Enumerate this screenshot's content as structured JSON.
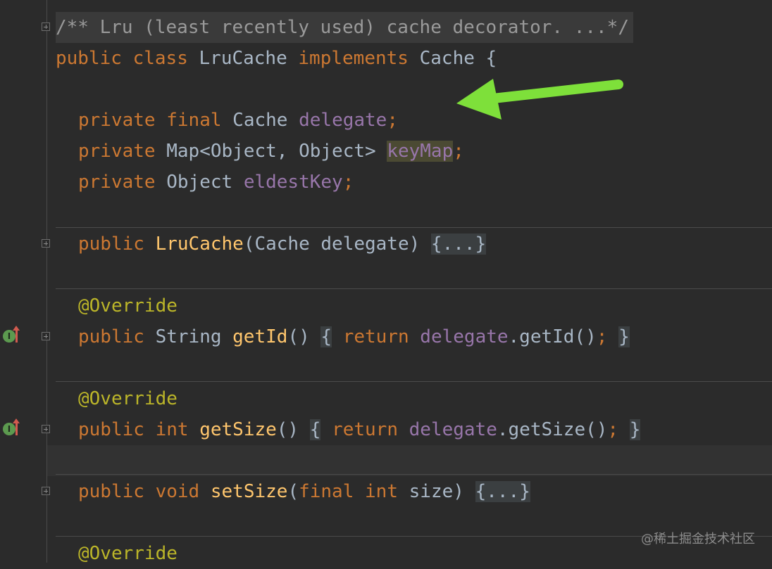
{
  "code": {
    "l1": {
      "text": "/** Lru (least recently used) cache decorator. ...*/"
    },
    "l2": {
      "kw1": "public",
      "kw2": "class",
      "name": "LruCache",
      "kw3": "implements",
      "iface": "Cache {"
    },
    "l4": {
      "kw1": "private",
      "kw2": "final",
      "type": "Cache",
      "field": "delegate",
      "semi": ";"
    },
    "l5": {
      "kw1": "private",
      "type": "Map<Object, Object>",
      "field": "keyMap",
      "semi": ";"
    },
    "l6": {
      "kw1": "private",
      "type": "Object",
      "field": "eldestKey",
      "semi": ";"
    },
    "l8": {
      "kw1": "public",
      "ctor": "LruCache",
      "params": "(Cache delegate)",
      "fold": "{...}"
    },
    "l10": {
      "ann": "@Override"
    },
    "l11": {
      "kw1": "public",
      "type": "String",
      "fn": "getId",
      "paren": "()",
      "open": "{",
      "kw2": "return",
      "field": "delegate",
      "call": ".getId()",
      "semi": ";",
      "close": "}"
    },
    "l13": {
      "ann": "@Override"
    },
    "l14": {
      "kw1": "public",
      "type": "int",
      "fn": "getSize",
      "paren": "()",
      "open": "{",
      "kw2": "return",
      "field": "delegate",
      "call": ".getSize()",
      "semi": ";",
      "close": "}"
    },
    "l16": {
      "kw1": "public",
      "kw2": "void",
      "fn": "setSize",
      "p1": "(",
      "kw3": "final",
      "kw4": "int",
      "p2": "size)",
      "fold": "{...}"
    },
    "l18": {
      "ann": "@Override"
    }
  },
  "gutter": {
    "implements_icon": "I"
  },
  "watermark": "@稀土掘金技术社区",
  "icons": [
    "fold-icon",
    "implements-icon",
    "override-up-arrow-icon",
    "green-arrow-annotation"
  ],
  "colors": {
    "keyword": "#cc7832",
    "field": "#9876aa",
    "function": "#ffc66d",
    "annotation": "#bbb529",
    "text": "#a9b7c6",
    "background": "#2b2b2b",
    "arrow": "#7ee03a"
  }
}
